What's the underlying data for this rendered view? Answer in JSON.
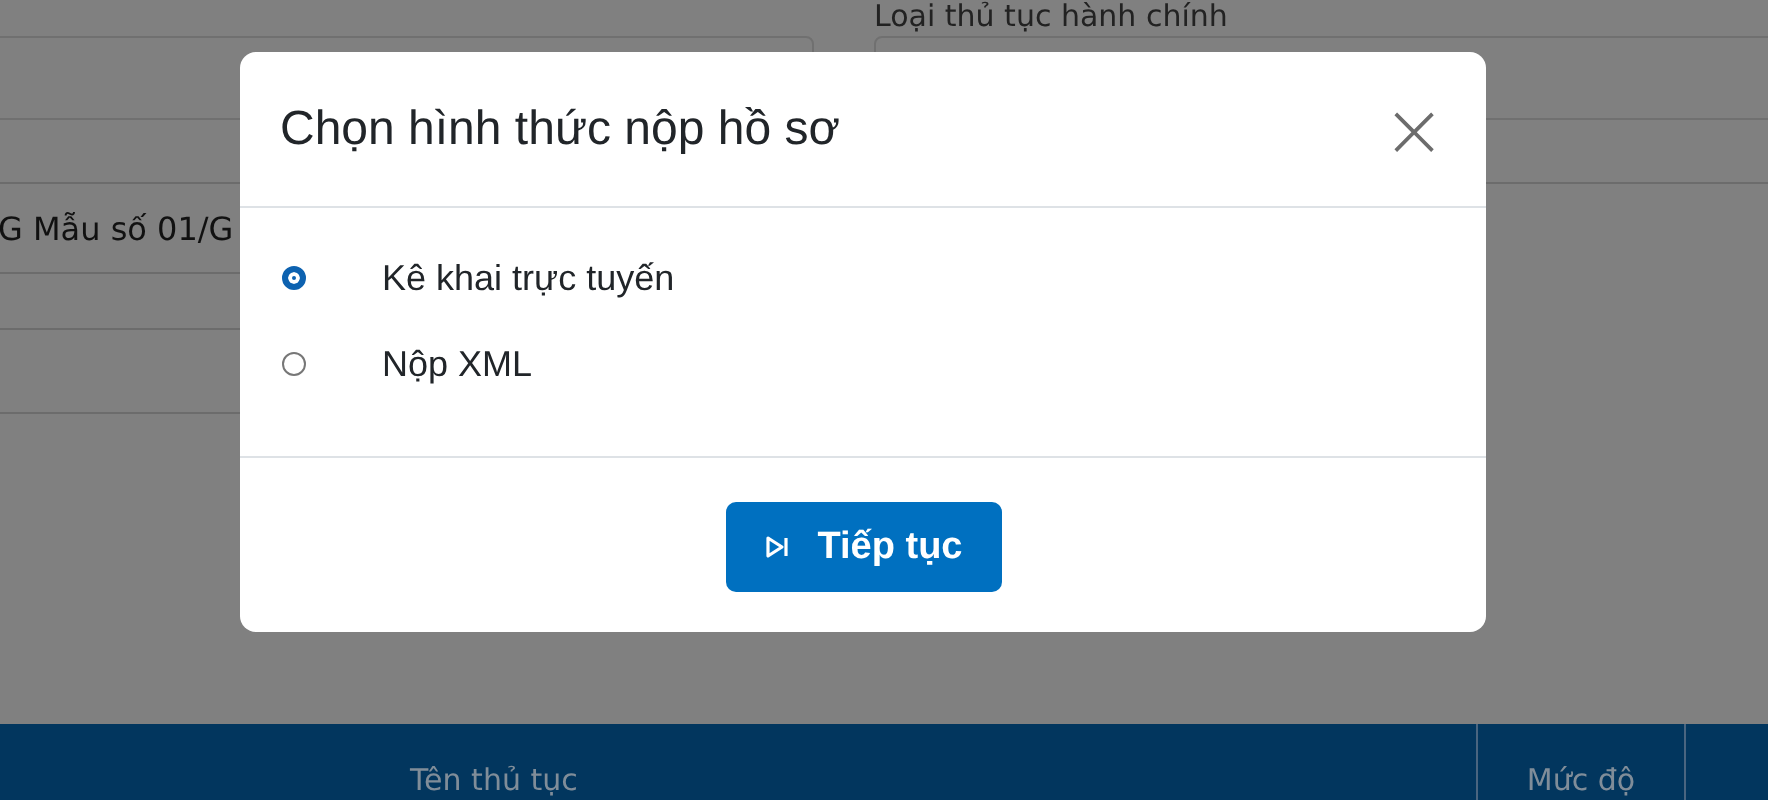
{
  "page": {
    "filter_label": "Loại thủ tục hành chính",
    "field_text": "G Mẫu số 01/G",
    "table_columns": [
      "Tên thủ tục",
      "Mức độ"
    ]
  },
  "dialog": {
    "title": "Chọn hình thức nộp hồ sơ",
    "close": "×",
    "options": [
      {
        "label": "Kê khai trực tuyến",
        "selected": true
      },
      {
        "label": "Nộp XML",
        "selected": false
      }
    ],
    "button": "Tiếp tục"
  }
}
